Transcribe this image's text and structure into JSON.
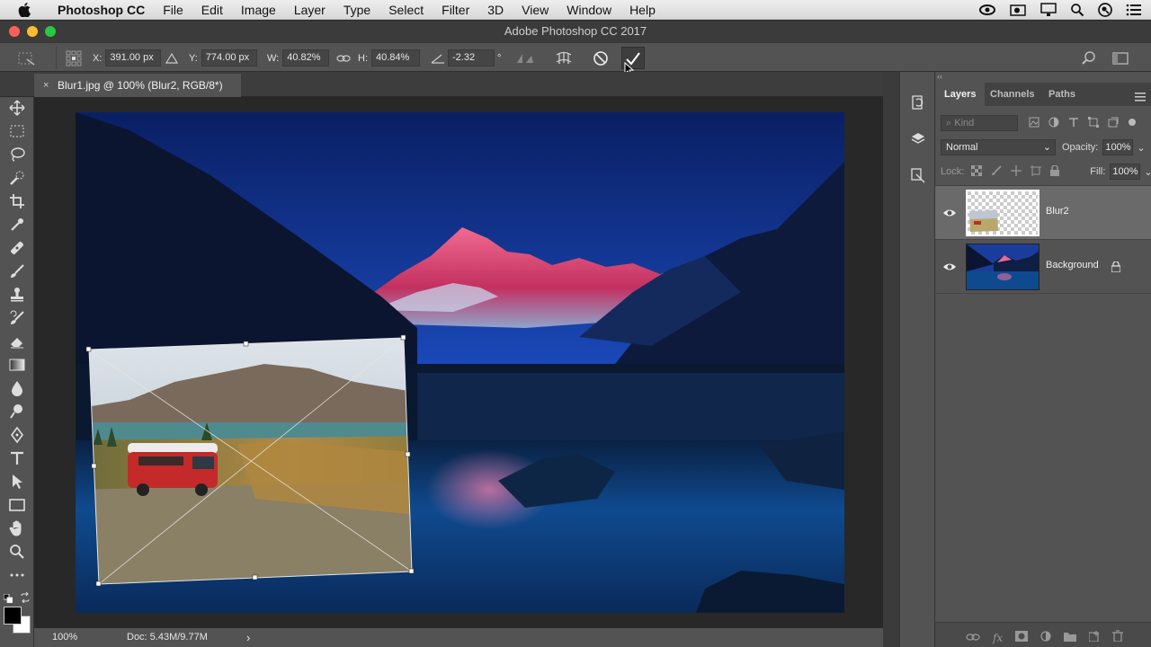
{
  "menubar": {
    "app_name": "Photoshop CC",
    "items": [
      "File",
      "Edit",
      "Image",
      "Layer",
      "Type",
      "Select",
      "Filter",
      "3D",
      "View",
      "Window",
      "Help"
    ]
  },
  "window": {
    "title": "Adobe Photoshop CC 2017"
  },
  "options": {
    "x_label": "X:",
    "x_value": "391.00 px",
    "y_label": "Y:",
    "y_value": "774.00 px",
    "w_label": "W:",
    "w_value": "40.82%",
    "h_label": "H:",
    "h_value": "40.84%",
    "angle_value": "-2.32",
    "angle_unit": "°"
  },
  "document_tab": {
    "title": "Blur1.jpg @ 100% (Blur2, RGB/8*)",
    "close": "×"
  },
  "status": {
    "zoom": "100%",
    "doc": "Doc: 5.43M/9.77M",
    "arrow": "›"
  },
  "layers_panel": {
    "tabs": [
      "Layers",
      "Channels",
      "Paths"
    ],
    "filter_placeholder": "Kind",
    "blend_mode": "Normal",
    "opacity_label": "Opacity:",
    "opacity_value": "100%",
    "lock_label": "Lock:",
    "fill_label": "Fill:",
    "fill_value": "100%",
    "layers": [
      {
        "name": "Blur2",
        "selected": true,
        "locked": false
      },
      {
        "name": "Background",
        "selected": false,
        "locked": true
      }
    ]
  },
  "colors": {
    "accent_selected_layer": "#6a6a6a",
    "panel_bg": "#535353",
    "canvas_bg": "#282828"
  }
}
